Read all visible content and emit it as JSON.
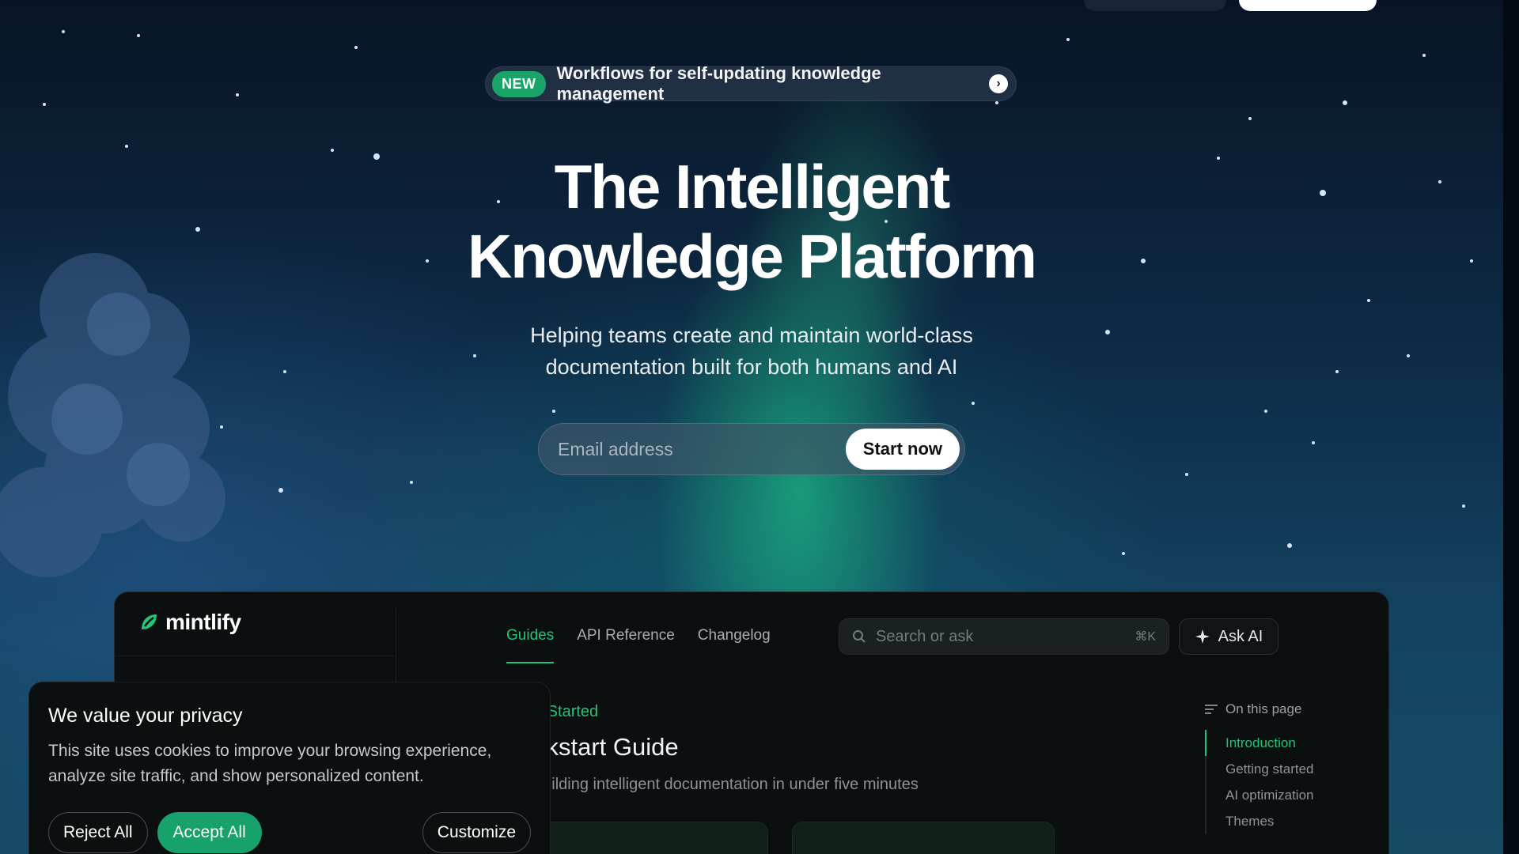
{
  "announcement": {
    "badge": "NEW",
    "text": "Workflows for self-updating knowledge management",
    "arrow_icon": "chevron-right-icon"
  },
  "hero": {
    "title_line1": "The Intelligent",
    "title_line2": "Knowledge Platform",
    "subtitle_line1": "Helping teams create and maintain world-class",
    "subtitle_line2": "documentation built for both humans and AI"
  },
  "signup": {
    "email_placeholder": "Email address",
    "cta_label": "Start now"
  },
  "app_preview": {
    "logo_text": "mintlify",
    "tabs": [
      {
        "label": "Guides",
        "active": true
      },
      {
        "label": "API Reference",
        "active": false
      },
      {
        "label": "Changelog",
        "active": false
      }
    ],
    "search_placeholder": "Search or ask",
    "search_shortcut": "⌘K",
    "ask_ai_label": "Ask AI",
    "breadcrumb": "g Started",
    "heading": "ckstart Guide",
    "description": "building intelligent documentation in under five minutes",
    "toc": {
      "title": "On this page",
      "items": [
        {
          "label": "Introduction",
          "active": true
        },
        {
          "label": "Getting started",
          "active": false
        },
        {
          "label": "AI optimization",
          "active": false
        },
        {
          "label": "Themes",
          "active": false
        }
      ]
    }
  },
  "cookie_banner": {
    "title": "We value your privacy",
    "body": "This site uses cookies to improve your browsing experience, analyze site traffic, and show personalized content.",
    "reject_label": "Reject All",
    "accept_label": "Accept All",
    "customize_label": "Customize"
  },
  "colors": {
    "accent_green": "#21c47c",
    "accept_green": "#16a26a",
    "sky_dark": "#081426"
  }
}
